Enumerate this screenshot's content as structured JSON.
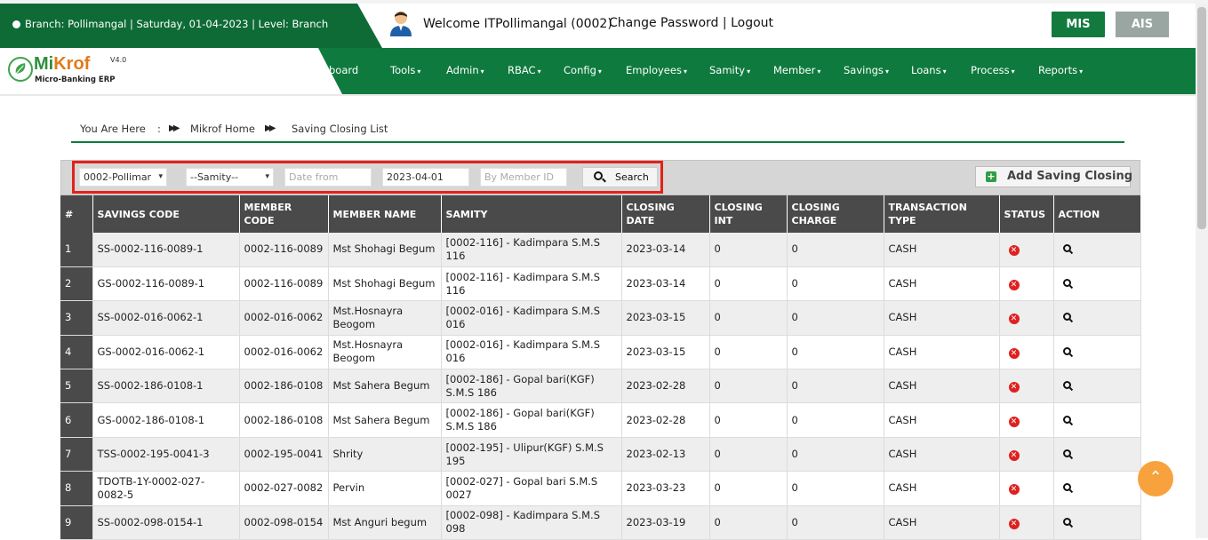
{
  "header": {
    "branch_info": "Branch: Pollimangal | Saturday, 01-04-2023 | Level: Branch",
    "welcome": "Welcome ITPollimangal (0002)",
    "change_password": "Change Password",
    "separator": "|",
    "logout": "Logout",
    "mis": "MIS",
    "ais": "AIS"
  },
  "logo": {
    "name_a": "Mi",
    "name_b": "Krof",
    "version": "V4.0",
    "subtitle": "Micro-Banking ERP"
  },
  "nav": {
    "items": [
      "board",
      "Tools",
      "Admin",
      "RBAC",
      "Config",
      "Employees",
      "Samity",
      "Member",
      "Savings",
      "Loans",
      "Process",
      "Reports"
    ],
    "caret": "▾"
  },
  "breadcrumb": {
    "you_are_here": "You Are Here",
    "colon": ":",
    "home": "Mikrof Home",
    "current": "Saving Closing List"
  },
  "filters": {
    "branch": "0002-Pollimar",
    "samity": "--Samity--",
    "date_from_placeholder": "Date from",
    "date_to": "2023-04-01",
    "member_placeholder": "By Member ID",
    "search_label": "Search",
    "add_label": "Add Saving Closing"
  },
  "table": {
    "headers": [
      "#",
      "SAVINGS CODE",
      "MEMBER CODE",
      "MEMBER NAME",
      "SAMITY",
      "CLOSING DATE",
      "CLOSING INT",
      "CLOSING CHARGE",
      "TRANSACTION TYPE",
      "STATUS",
      "ACTION"
    ],
    "rows": [
      {
        "n": "1",
        "code": "SS-0002-116-0089-1",
        "member_code": "0002-116-0089",
        "name": "Mst Shohagi Begum",
        "samity": "[0002-116] - Kadimpara S.M.S 116",
        "date": "2023-03-14",
        "int": "0",
        "charge": "0",
        "type": "CASH"
      },
      {
        "n": "2",
        "code": "GS-0002-116-0089-1",
        "member_code": "0002-116-0089",
        "name": "Mst Shohagi Begum",
        "samity": "[0002-116] - Kadimpara S.M.S 116",
        "date": "2023-03-14",
        "int": "0",
        "charge": "0",
        "type": "CASH"
      },
      {
        "n": "3",
        "code": "SS-0002-016-0062-1",
        "member_code": "0002-016-0062",
        "name": "Mst.Hosnayra Beogom",
        "samity": "[0002-016] - Kadimpara S.M.S 016",
        "date": "2023-03-15",
        "int": "0",
        "charge": "0",
        "type": "CASH"
      },
      {
        "n": "4",
        "code": "GS-0002-016-0062-1",
        "member_code": "0002-016-0062",
        "name": "Mst.Hosnayra Beogom",
        "samity": "[0002-016] - Kadimpara S.M.S 016",
        "date": "2023-03-15",
        "int": "0",
        "charge": "0",
        "type": "CASH"
      },
      {
        "n": "5",
        "code": "SS-0002-186-0108-1",
        "member_code": "0002-186-0108",
        "name": "Mst Sahera Begum",
        "samity": "[0002-186] - Gopal bari(KGF) S.M.S 186",
        "date": "2023-02-28",
        "int": "0",
        "charge": "0",
        "type": "CASH"
      },
      {
        "n": "6",
        "code": "GS-0002-186-0108-1",
        "member_code": "0002-186-0108",
        "name": "Mst Sahera Begum",
        "samity": "[0002-186] - Gopal bari(KGF) S.M.S 186",
        "date": "2023-02-28",
        "int": "0",
        "charge": "0",
        "type": "CASH"
      },
      {
        "n": "7",
        "code": "TSS-0002-195-0041-3",
        "member_code": "0002-195-0041",
        "name": "Shrity",
        "samity": "[0002-195] - Ulipur(KGF) S.M.S 195",
        "date": "2023-02-13",
        "int": "0",
        "charge": "0",
        "type": "CASH"
      },
      {
        "n": "8",
        "code": "TDOTB-1Y-0002-027-0082-5",
        "member_code": "0002-027-0082",
        "name": "Pervin",
        "samity": "[0002-027] - Gopal bari S.M.S 0027",
        "date": "2023-03-23",
        "int": "0",
        "charge": "0",
        "type": "CASH"
      },
      {
        "n": "9",
        "code": "SS-0002-098-0154-1",
        "member_code": "0002-098-0154",
        "name": "Mst Anguri begum",
        "samity": "[0002-098] - Kadimpara S.M.S 098",
        "date": "2023-03-19",
        "int": "0",
        "charge": "0",
        "type": "CASH"
      }
    ]
  },
  "icons": {
    "status": "delete-icon",
    "action": "view-icon",
    "to_top": "chevron-up-icon"
  },
  "colors": {
    "brand_green": "#0e7a3e",
    "highlight_red": "#e32119",
    "header_dark": "#4a4a4a",
    "accent_orange": "#f7a23c"
  }
}
